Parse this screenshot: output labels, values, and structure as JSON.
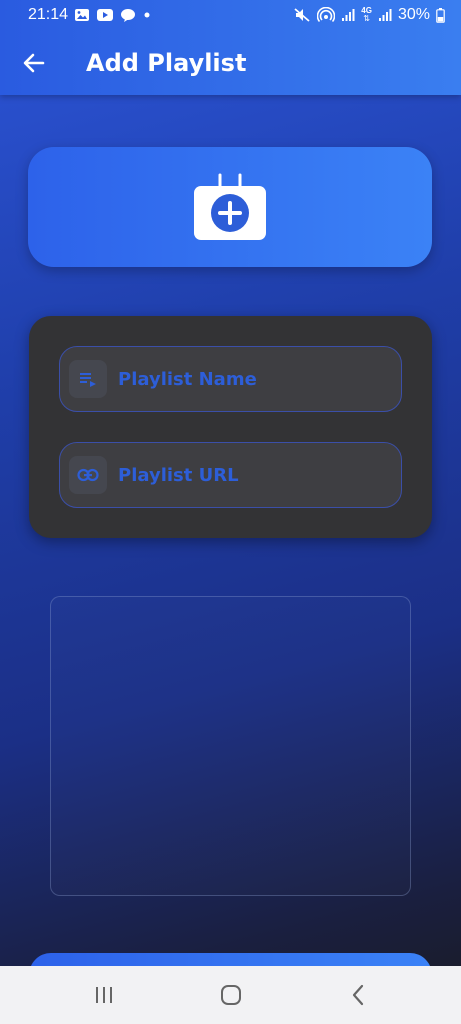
{
  "status_bar": {
    "time": "21:14",
    "network_label": "4G",
    "battery": "30%",
    "left_icons": [
      "gallery-icon",
      "youtube-icon",
      "chat-icon",
      "dot-icon"
    ],
    "right_icons": [
      "mute-icon",
      "hotspot-icon",
      "signal-icon",
      "signal-4g-icon",
      "signal-icon",
      "battery-icon"
    ]
  },
  "app_bar": {
    "title": "Add Playlist",
    "back_icon": "arrow-left-icon"
  },
  "hero": {
    "icon": "add-tv-icon"
  },
  "form": {
    "name_field": {
      "placeholder": "Playlist Name",
      "value": "",
      "icon": "playlist-icon"
    },
    "url_field": {
      "placeholder": "Playlist URL",
      "value": "",
      "icon": "link-icon"
    }
  },
  "nav_bar": {
    "items": [
      "recents-icon",
      "home-icon",
      "back-icon"
    ]
  },
  "colors": {
    "accent": "#2d5ed8",
    "header_start": "#2a5be0",
    "header_end": "#3a7ef0",
    "card_dark": "#333335",
    "nav_bar": "#f2f2f4"
  }
}
